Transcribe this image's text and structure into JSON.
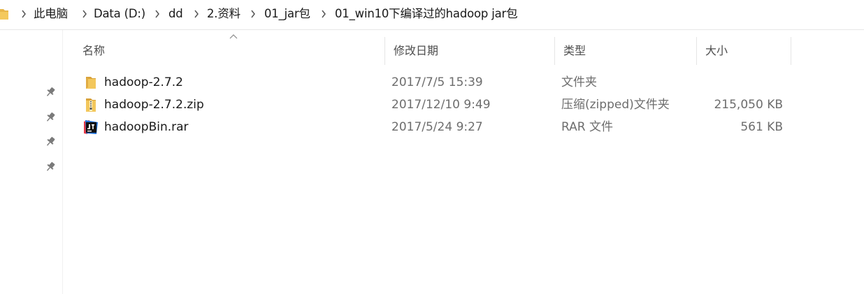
{
  "breadcrumb": {
    "items": [
      "此电脑",
      "Data (D:)",
      "dd",
      "2.资料",
      "01_jar包",
      "01_win10下编译过的hadoop jar包"
    ]
  },
  "columns": {
    "name": "名称",
    "date": "修改日期",
    "type": "类型",
    "size": "大小"
  },
  "files": [
    {
      "name": "hadoop-2.7.2",
      "date": "2017/7/5 15:39",
      "type": "文件夹",
      "size": "",
      "icon": "folder-icon"
    },
    {
      "name": "hadoop-2.7.2.zip",
      "date": "2017/12/10 9:49",
      "type": "压缩(zipped)文件夹",
      "size": "215,050 KB",
      "icon": "zip-folder-icon"
    },
    {
      "name": "hadoopBin.rar",
      "date": "2017/5/24 9:27",
      "type": "RAR 文件",
      "size": "561 KB",
      "icon": "rar-archive-icon"
    }
  ],
  "colors": {
    "folder": "#e8b64a",
    "text": "#1a1a1a",
    "muted": "#6d6d6d"
  }
}
